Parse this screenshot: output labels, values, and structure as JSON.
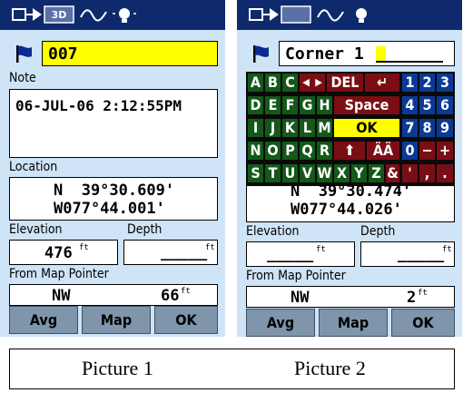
{
  "screen1": {
    "name_value": "007",
    "note_label": "Note",
    "note_value": "06-JUL-06 2:12:55PM",
    "location_label": "Location",
    "lat": "N  39°30.609'",
    "lon": "W077°44.001'",
    "elevation_label": "Elevation",
    "elevation_value": "476",
    "elevation_unit": "ft",
    "depth_label": "Depth",
    "depth_value": "_____",
    "depth_unit": "ft",
    "from_label": "From Map Pointer",
    "bearing": "NW",
    "distance": "66",
    "distance_unit": "ft",
    "buttons": {
      "avg": "Avg",
      "map": "Map",
      "ok": "OK"
    }
  },
  "screen2": {
    "name_value": "Corner 1",
    "keyboard": {
      "row1": [
        "A",
        "B",
        "C",
        "◀",
        "▶",
        "DEL",
        "↵",
        "1",
        "2",
        "3"
      ],
      "row2": [
        "D",
        "E",
        "F",
        "G",
        "H",
        "Space",
        "4",
        "5",
        "6"
      ],
      "row3": [
        "I",
        "J",
        "K",
        "L",
        "M",
        "OK",
        "7",
        "8",
        "9"
      ],
      "row4": [
        "N",
        "O",
        "P",
        "Q",
        "R",
        "⬆",
        "ÄÄ",
        "0",
        "−",
        "+"
      ],
      "row5": [
        "S",
        "T",
        "U",
        "V",
        "W",
        "X",
        "Y",
        "Z",
        "&",
        "'",
        ",",
        "."
      ]
    },
    "lat": "N  39°30.474'",
    "lon": "W077°44.026'",
    "elevation_label": "Elevation",
    "elevation_value": "_____",
    "elevation_unit": "ft",
    "depth_label": "Depth",
    "depth_value": "_____",
    "depth_unit": "ft",
    "from_label": "From Map Pointer",
    "bearing": "NW",
    "distance": "2",
    "distance_unit": "ft",
    "buttons": {
      "avg": "Avg",
      "map": "Map",
      "ok": "OK"
    }
  },
  "captions": {
    "picture1": "Picture 1",
    "picture2": "Picture 2"
  }
}
